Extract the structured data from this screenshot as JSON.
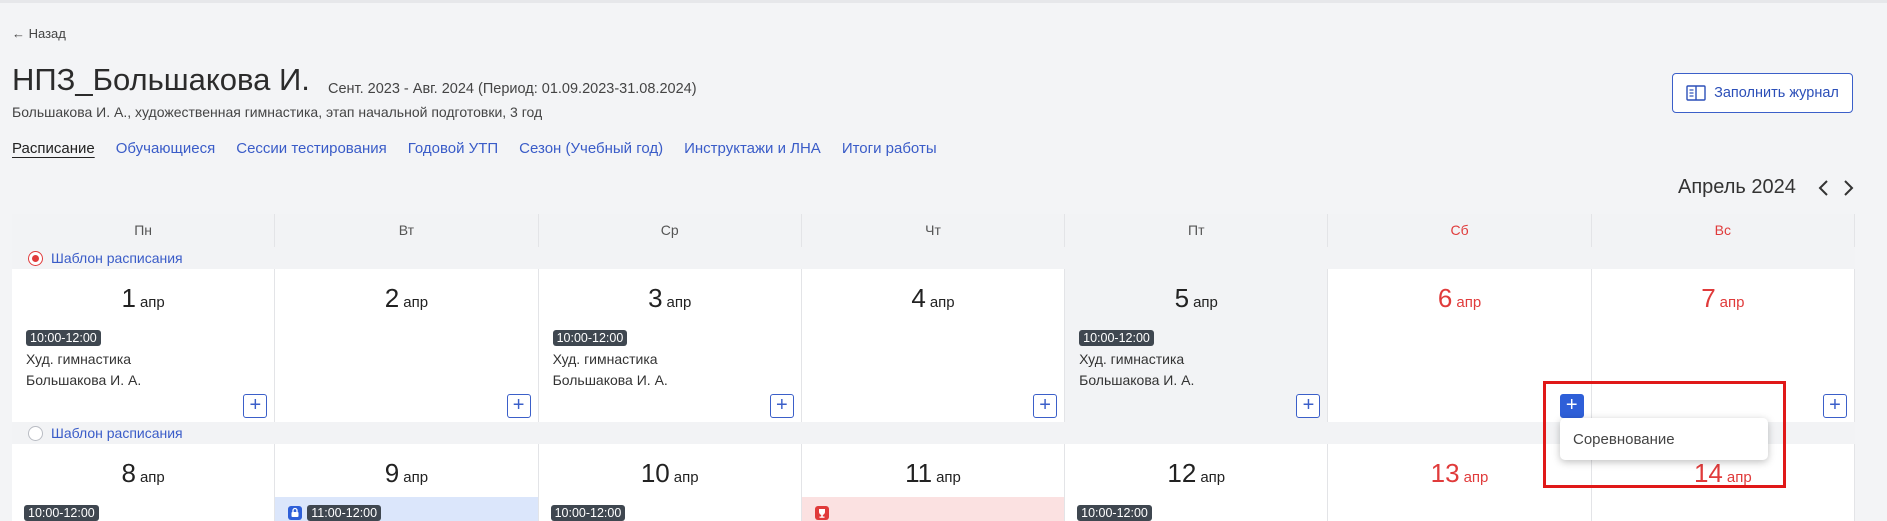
{
  "back_label": "← Назад",
  "header": {
    "title": "НПЗ_Большакова И.",
    "period": "Сент. 2023 - Авг. 2024 (Период: 01.09.2023-31.08.2024)",
    "subtitle": "Большакова И. А., художественная гимнастика, этап начальной подготовки, 3 год",
    "fill_button": "Заполнить журнал"
  },
  "tabs": [
    "Расписание",
    "Обучающиеся",
    "Сессии тестирования",
    "Годовой УТП",
    "Сезон (Учебный год)",
    "Инструктажи и ЛНА",
    "Итоги работы"
  ],
  "calendar": {
    "month_label": "Апрель 2024",
    "weekdays": [
      "Пн",
      "Вт",
      "Ср",
      "Чт",
      "Пт",
      "Сб",
      "Вс"
    ],
    "template_label": "Шаблон расписания",
    "month_abbr": "апр",
    "week1": {
      "days": [
        "1",
        "2",
        "3",
        "4",
        "5",
        "6",
        "7"
      ],
      "event": {
        "time": "10:00-12:00",
        "name": "Худ. гимнастика",
        "coach": "Большакова И. А."
      }
    },
    "week2": {
      "days": [
        "8",
        "9",
        "10",
        "11",
        "12",
        "13",
        "14"
      ],
      "times": {
        "mon": "10:00-12:00",
        "tue": "11:00-12:00",
        "wed": "10:00-12:00",
        "fri": "10:00-12:00"
      }
    }
  },
  "dropdown": {
    "item": "Соревнование"
  },
  "colors": {
    "accent": "#2e5fd8",
    "weekend": "#e03b3b",
    "highlight": "#e01818"
  }
}
